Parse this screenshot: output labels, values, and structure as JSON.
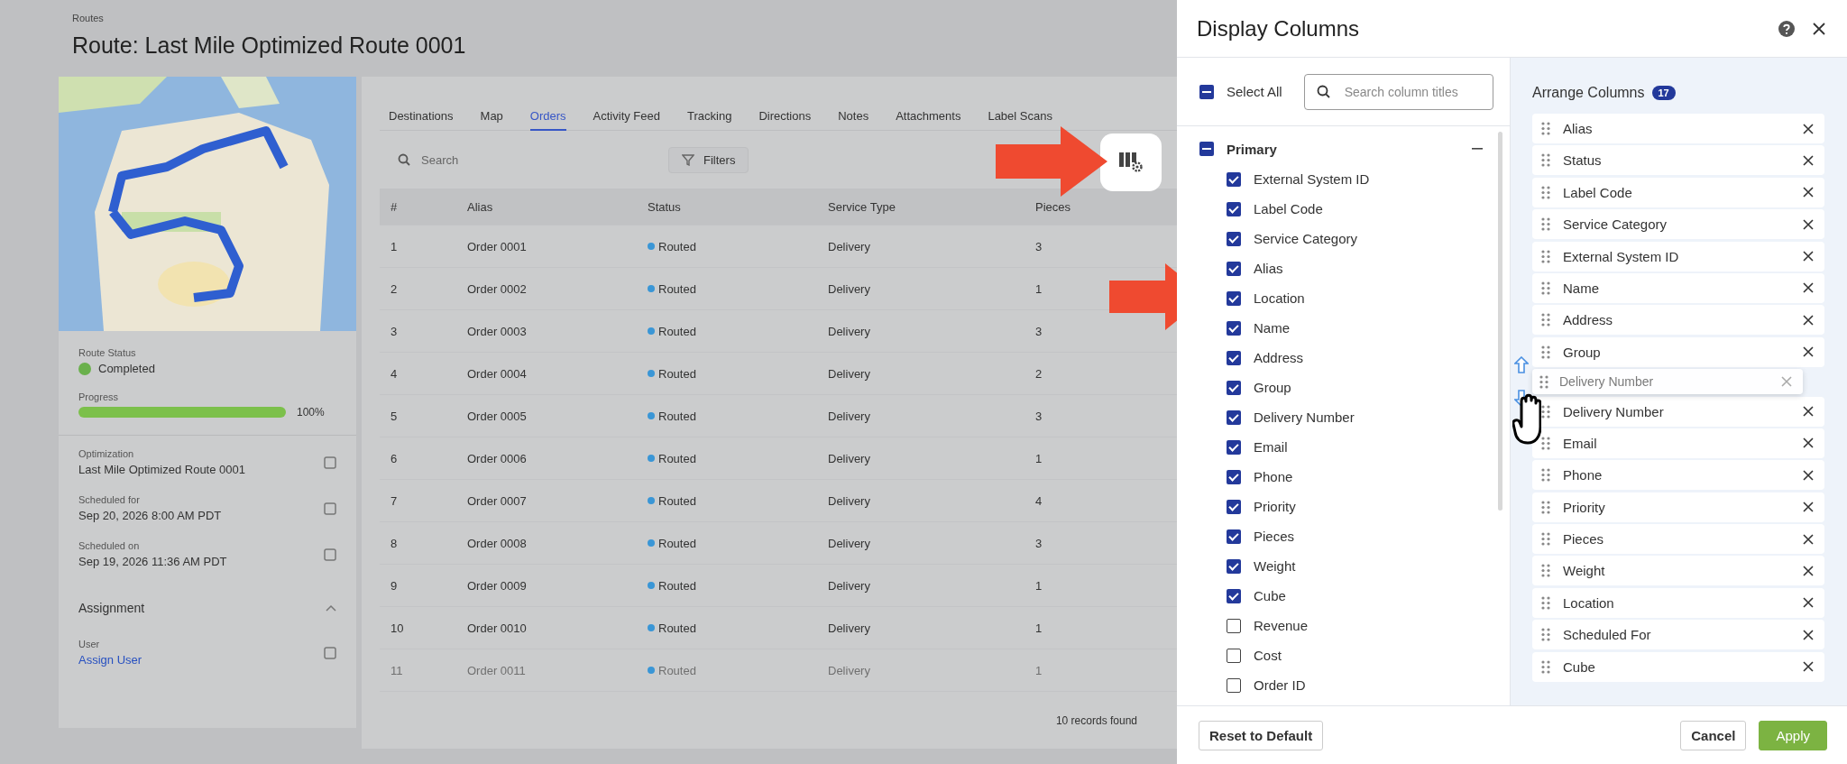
{
  "background": {
    "breadcrumb": "Routes",
    "title": "Route: Last Mile Optimized Route 0001",
    "route_status": {
      "label": "Route Status",
      "value": "Completed",
      "color": "#6ab04c"
    },
    "progress": {
      "label": "Progress",
      "level": 1,
      "reading": "100%"
    },
    "details": [
      {
        "label": "Optimization",
        "value": "Last Mile Optimized Route 0001"
      },
      {
        "label": "Scheduled for",
        "value": "Sep 20, 2026 8:00 AM PDT"
      },
      {
        "label": "Scheduled on",
        "value": "Sep 19, 2026 11:36 AM PDT"
      }
    ],
    "assignment": {
      "title": "Assignment",
      "expanded": true
    },
    "user": {
      "label": "User",
      "value": "Assign User"
    },
    "tabs": [
      {
        "label": "Destinations",
        "selected": false
      },
      {
        "label": "Map",
        "selected": false
      },
      {
        "label": "Orders",
        "selected": true
      },
      {
        "label": "Activity Feed",
        "selected": false
      },
      {
        "label": "Tracking",
        "selected": false
      },
      {
        "label": "Directions",
        "selected": false
      },
      {
        "label": "Notes",
        "selected": false
      },
      {
        "label": "Attachments",
        "selected": false
      },
      {
        "label": "Label Scans",
        "selected": false
      }
    ],
    "search": {
      "placeholder": "Search"
    },
    "filters_button": "Filters",
    "table": {
      "columns": [
        "#",
        "Alias",
        "Status",
        "Service Type",
        "Pieces"
      ],
      "rows": [
        {
          "cells": [
            "1",
            "Order 0001",
            "Routed",
            "Delivery",
            "3"
          ],
          "faded": false
        },
        {
          "cells": [
            "2",
            "Order 0002",
            "Routed",
            "Delivery",
            "1"
          ],
          "faded": false
        },
        {
          "cells": [
            "3",
            "Order 0003",
            "Routed",
            "Delivery",
            "3"
          ],
          "faded": false
        },
        {
          "cells": [
            "4",
            "Order 0004",
            "Routed",
            "Delivery",
            "2"
          ],
          "faded": false
        },
        {
          "cells": [
            "5",
            "Order 0005",
            "Routed",
            "Delivery",
            "3"
          ],
          "faded": false
        },
        {
          "cells": [
            "6",
            "Order 0006",
            "Routed",
            "Delivery",
            "1"
          ],
          "faded": false
        },
        {
          "cells": [
            "7",
            "Order 0007",
            "Routed",
            "Delivery",
            "4"
          ],
          "faded": false
        },
        {
          "cells": [
            "8",
            "Order 0008",
            "Routed",
            "Delivery",
            "3"
          ],
          "faded": false
        },
        {
          "cells": [
            "9",
            "Order 0009",
            "Routed",
            "Delivery",
            "1"
          ],
          "faded": false
        },
        {
          "cells": [
            "10",
            "Order 0010",
            "Routed",
            "Delivery",
            "1"
          ],
          "faded": false
        },
        {
          "cells": [
            "11",
            "Order 0011",
            "Routed",
            "Delivery",
            "1"
          ],
          "faded": true
        }
      ]
    },
    "records": "10 records found"
  },
  "dialog": {
    "title": "Display Columns",
    "select_all": {
      "label": "Select All",
      "indeterminate": true
    },
    "search": {
      "placeholder": "Search column titles"
    },
    "groups": [
      {
        "label": "Primary",
        "indeterminate": true,
        "expanded": true,
        "items": [
          {
            "label": "External System ID",
            "checked": true
          },
          {
            "label": "Label Code",
            "checked": true
          },
          {
            "label": "Service Category",
            "checked": true
          },
          {
            "label": "Alias",
            "checked": true
          },
          {
            "label": "Location",
            "checked": true
          },
          {
            "label": "Name",
            "checked": true
          },
          {
            "label": "Address",
            "checked": true
          },
          {
            "label": "Group",
            "checked": true
          },
          {
            "label": "Delivery Number",
            "checked": true
          },
          {
            "label": "Email",
            "checked": true
          },
          {
            "label": "Phone",
            "checked": true
          },
          {
            "label": "Priority",
            "checked": true
          },
          {
            "label": "Pieces",
            "checked": true
          },
          {
            "label": "Weight",
            "checked": true
          },
          {
            "label": "Cube",
            "checked": true
          },
          {
            "label": "Revenue",
            "checked": false
          },
          {
            "label": "Cost",
            "checked": false
          },
          {
            "label": "Order ID",
            "checked": false
          }
        ]
      }
    ],
    "arrange": {
      "title": "Arrange Columns",
      "count": "17",
      "items": [
        {
          "label": "Alias",
          "dragged": false
        },
        {
          "label": "Status",
          "dragged": false
        },
        {
          "label": "Label Code",
          "dragged": false
        },
        {
          "label": "Service Category",
          "dragged": false
        },
        {
          "label": "External System ID",
          "dragged": false
        },
        {
          "label": "Name",
          "dragged": false
        },
        {
          "label": "Address",
          "dragged": false
        },
        {
          "label": "Group",
          "dragged": false
        },
        {
          "label": "Delivery Number",
          "dragged": true
        },
        {
          "label": "Email",
          "dragged": false
        },
        {
          "label": "Phone",
          "dragged": false
        },
        {
          "label": "Priority",
          "dragged": false
        },
        {
          "label": "Pieces",
          "dragged": false
        },
        {
          "label": "Weight",
          "dragged": false
        },
        {
          "label": "Location",
          "dragged": false
        },
        {
          "label": "Scheduled For",
          "dragged": false
        },
        {
          "label": "Cube",
          "dragged": false
        }
      ],
      "dragging": {
        "label": "Delivery Number"
      }
    },
    "buttons": {
      "reset": "Reset to Default",
      "cancel": "Cancel",
      "apply": "Apply"
    }
  }
}
